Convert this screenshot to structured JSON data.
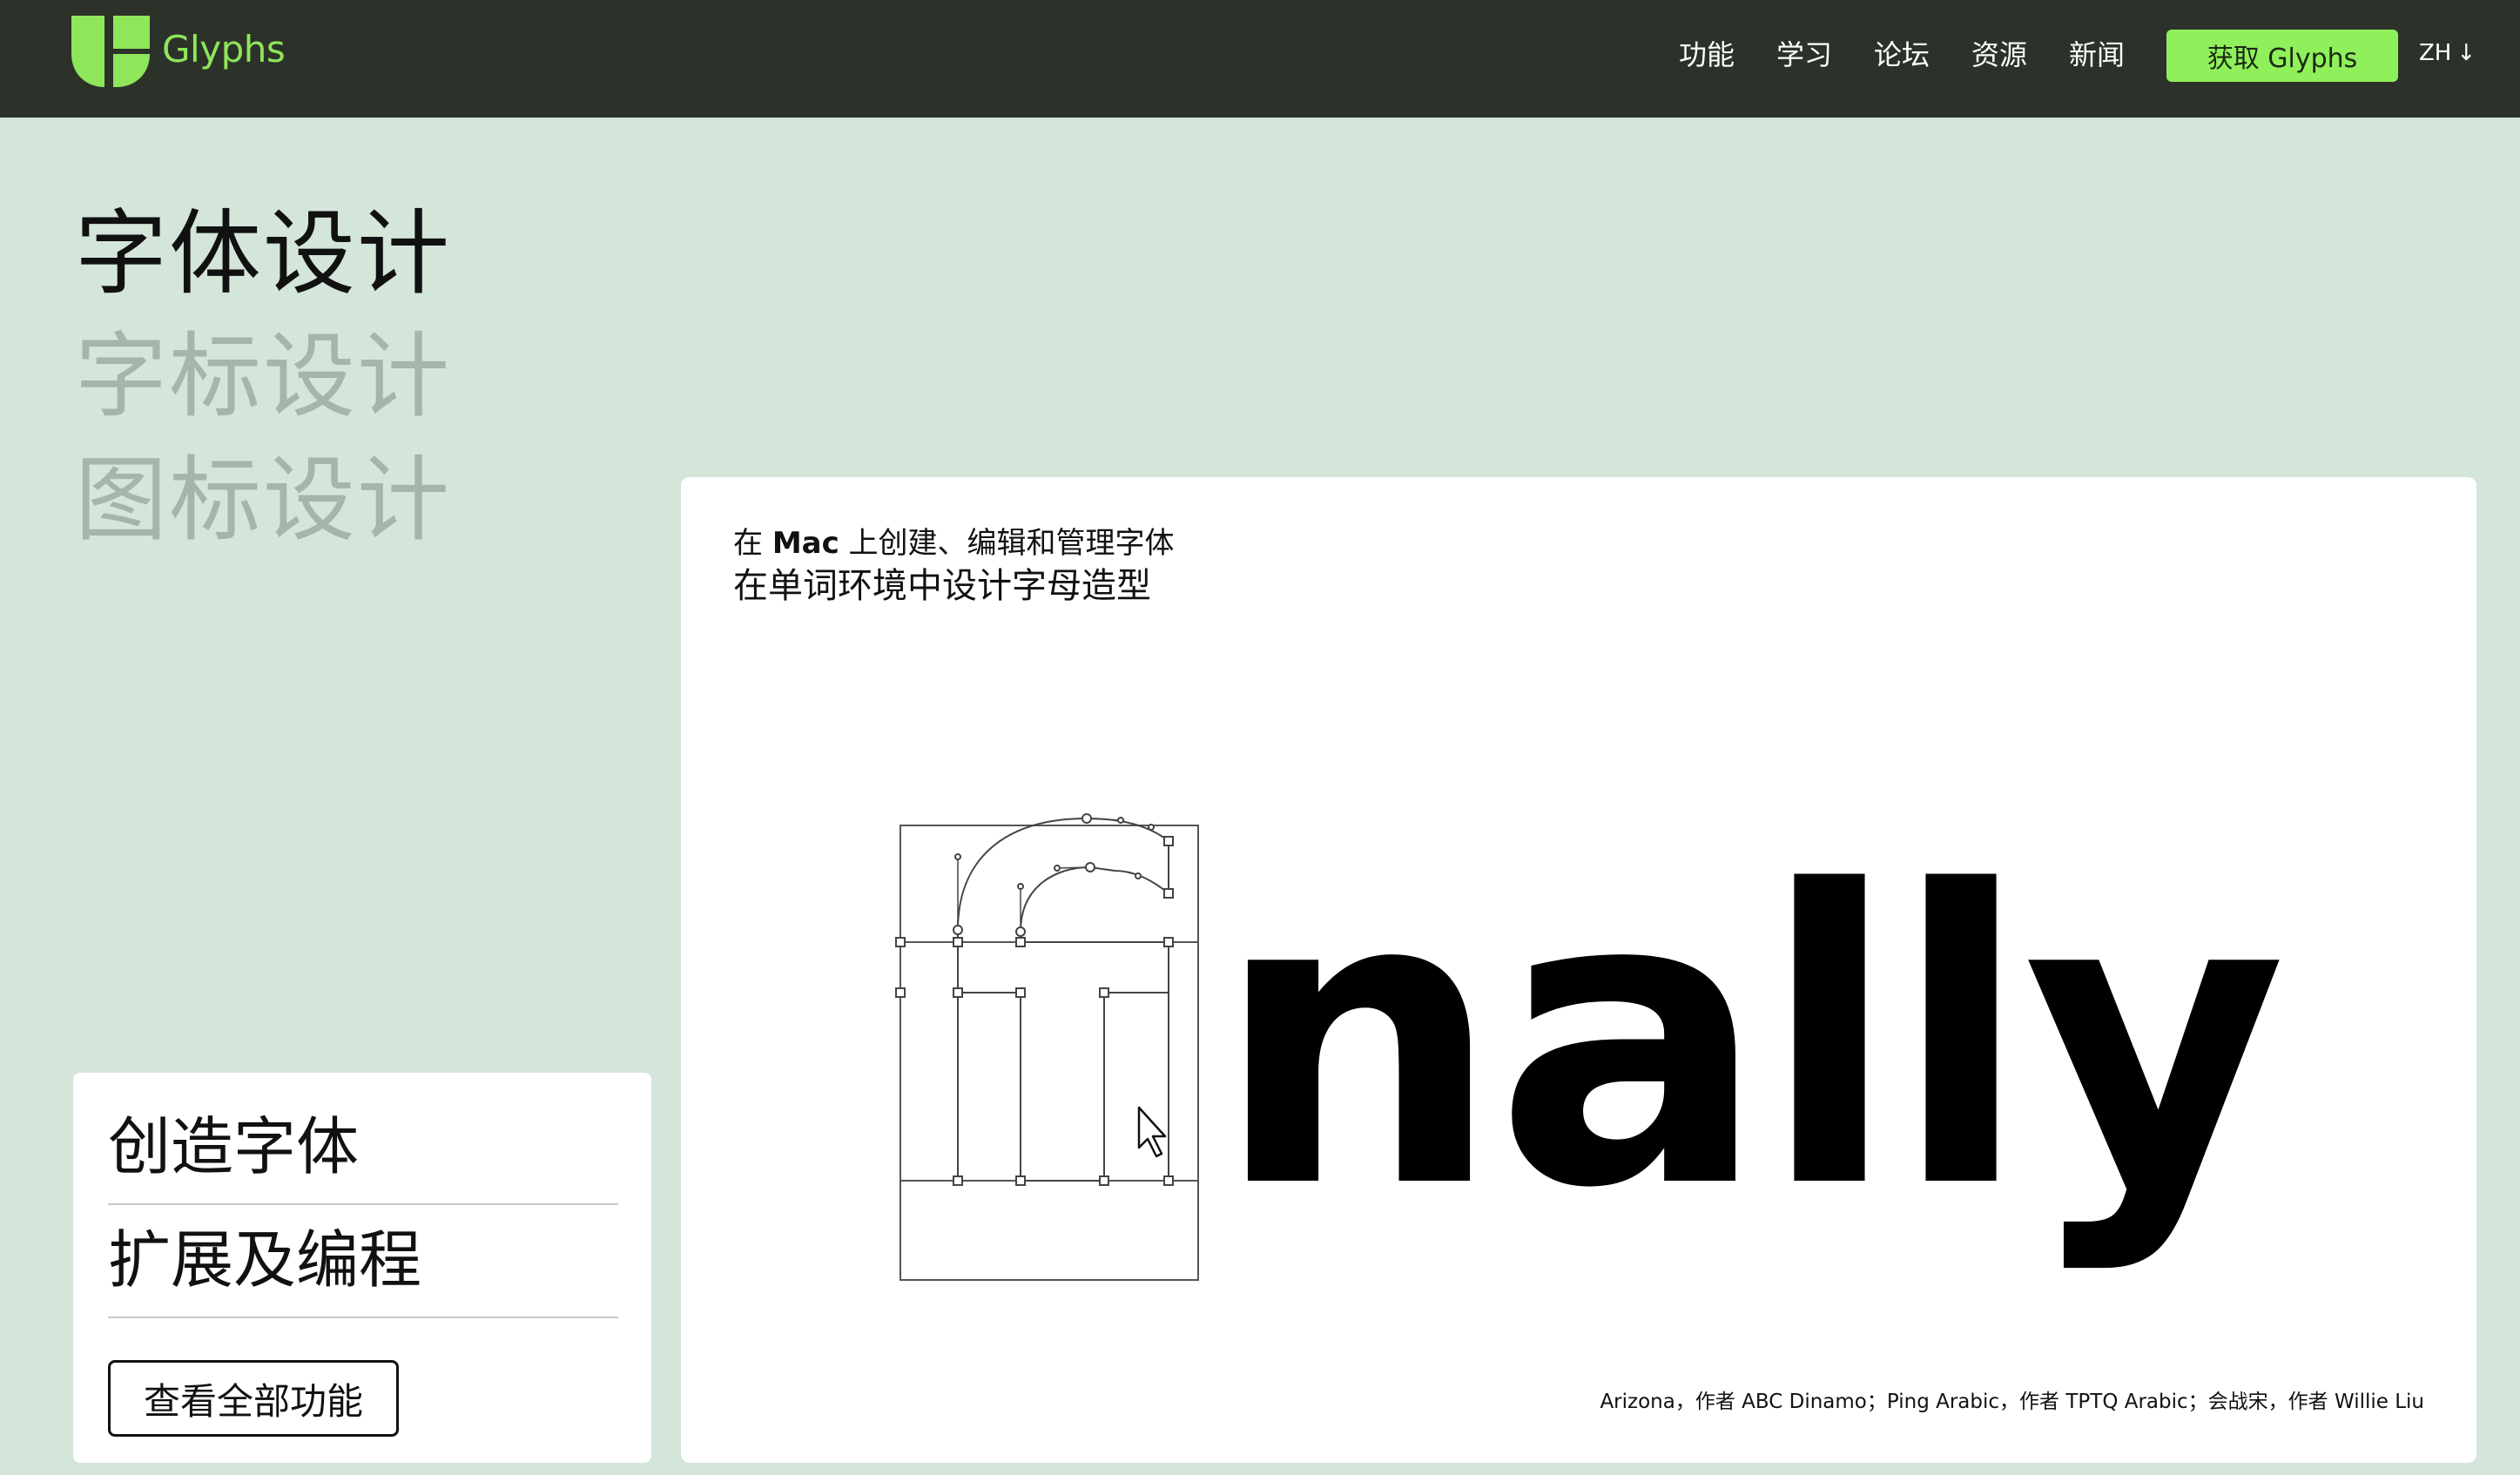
{
  "header": {
    "brand": "Glyphs",
    "nav": [
      "功能",
      "学习",
      "论坛",
      "资源",
      "新闻"
    ],
    "cta": "获取 Glyphs",
    "lang": "ZH"
  },
  "hero": {
    "headlines": [
      "字体设计",
      "字标设计",
      "图标设计"
    ]
  },
  "features": {
    "items": [
      "创造字体",
      "扩展及编程"
    ],
    "button": "查看全部功能"
  },
  "demo": {
    "desc_prefix": "在 ",
    "desc_bold": "Mac",
    "desc_suffix": " 上创建、编辑和管理字体",
    "subtitle": "在单词环境中设计字母造型",
    "word": "nally",
    "credits": "Arizona，作者 ABC Dinamo；Ping Arabic，作者 TPTQ Arabic；会战宋，作者 Willie Liu"
  },
  "colors": {
    "page_bg": "#d4e5da",
    "topbar": "#2c3229",
    "accent": "#8ff05c",
    "brand_text": "#8ee65a",
    "muted_headline": "#a6b4ab"
  },
  "icons": {
    "logo": "glyphs-logo-icon",
    "lang_arrow": "arrow-down-icon",
    "cursor": "pointer-cursor-icon"
  }
}
